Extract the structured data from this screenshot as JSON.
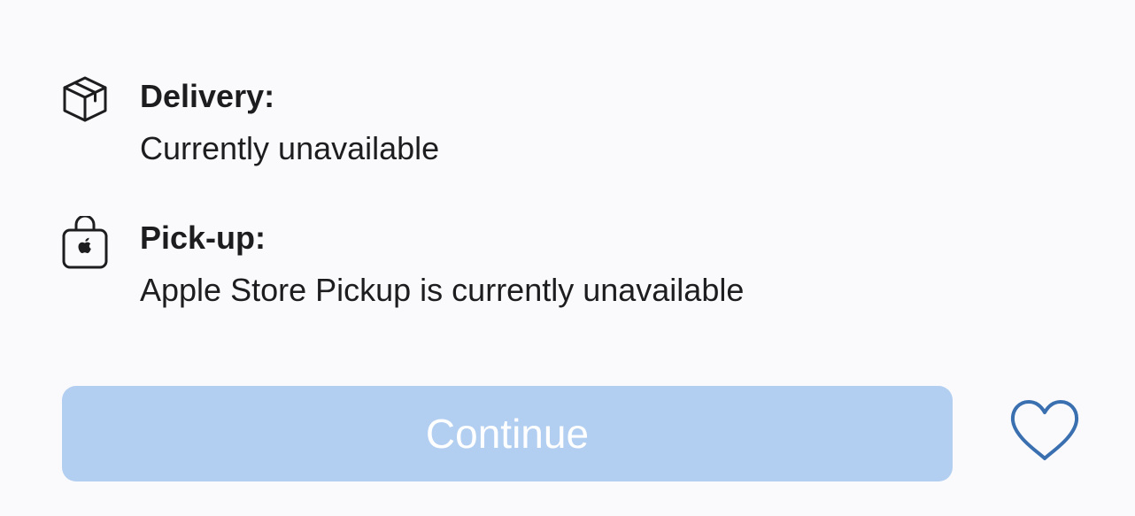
{
  "fulfillment": {
    "delivery": {
      "icon": "package-icon",
      "label": "Delivery:",
      "status": "Currently unavailable"
    },
    "pickup": {
      "icon": "shopping-bag-apple-icon",
      "label": "Pick-up:",
      "status": "Apple Store Pickup is currently unavailable"
    }
  },
  "actions": {
    "continue_label": "Continue",
    "continue_color": "#b2cef0",
    "favorite_icon": "heart-icon",
    "favorite_color": "#3a6fb0"
  }
}
